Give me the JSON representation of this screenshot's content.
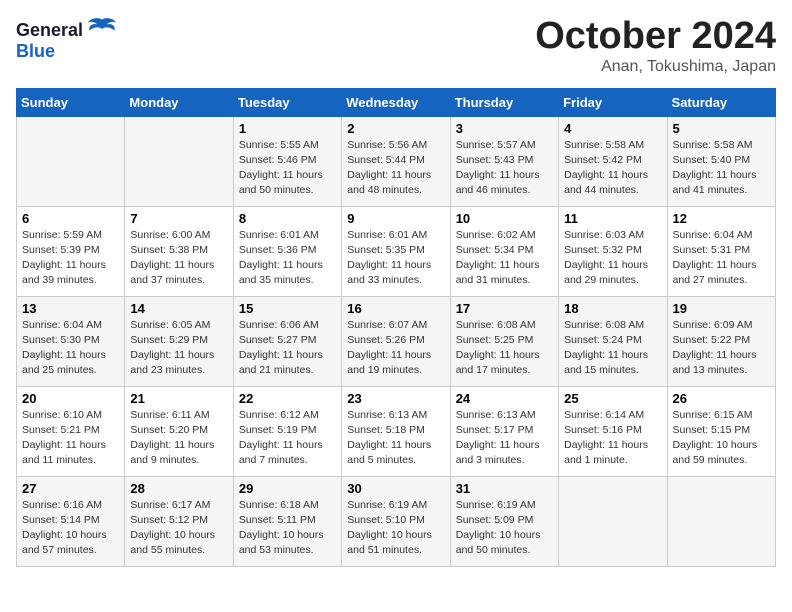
{
  "logo": {
    "general": "General",
    "blue": "Blue"
  },
  "title": "October 2024",
  "location": "Anan, Tokushima, Japan",
  "days_of_week": [
    "Sunday",
    "Monday",
    "Tuesday",
    "Wednesday",
    "Thursday",
    "Friday",
    "Saturday"
  ],
  "weeks": [
    [
      {
        "day": "",
        "info": ""
      },
      {
        "day": "",
        "info": ""
      },
      {
        "day": "1",
        "info": "Sunrise: 5:55 AM\nSunset: 5:46 PM\nDaylight: 11 hours and 50 minutes."
      },
      {
        "day": "2",
        "info": "Sunrise: 5:56 AM\nSunset: 5:44 PM\nDaylight: 11 hours and 48 minutes."
      },
      {
        "day": "3",
        "info": "Sunrise: 5:57 AM\nSunset: 5:43 PM\nDaylight: 11 hours and 46 minutes."
      },
      {
        "day": "4",
        "info": "Sunrise: 5:58 AM\nSunset: 5:42 PM\nDaylight: 11 hours and 44 minutes."
      },
      {
        "day": "5",
        "info": "Sunrise: 5:58 AM\nSunset: 5:40 PM\nDaylight: 11 hours and 41 minutes."
      }
    ],
    [
      {
        "day": "6",
        "info": "Sunrise: 5:59 AM\nSunset: 5:39 PM\nDaylight: 11 hours and 39 minutes."
      },
      {
        "day": "7",
        "info": "Sunrise: 6:00 AM\nSunset: 5:38 PM\nDaylight: 11 hours and 37 minutes."
      },
      {
        "day": "8",
        "info": "Sunrise: 6:01 AM\nSunset: 5:36 PM\nDaylight: 11 hours and 35 minutes."
      },
      {
        "day": "9",
        "info": "Sunrise: 6:01 AM\nSunset: 5:35 PM\nDaylight: 11 hours and 33 minutes."
      },
      {
        "day": "10",
        "info": "Sunrise: 6:02 AM\nSunset: 5:34 PM\nDaylight: 11 hours and 31 minutes."
      },
      {
        "day": "11",
        "info": "Sunrise: 6:03 AM\nSunset: 5:32 PM\nDaylight: 11 hours and 29 minutes."
      },
      {
        "day": "12",
        "info": "Sunrise: 6:04 AM\nSunset: 5:31 PM\nDaylight: 11 hours and 27 minutes."
      }
    ],
    [
      {
        "day": "13",
        "info": "Sunrise: 6:04 AM\nSunset: 5:30 PM\nDaylight: 11 hours and 25 minutes."
      },
      {
        "day": "14",
        "info": "Sunrise: 6:05 AM\nSunset: 5:29 PM\nDaylight: 11 hours and 23 minutes."
      },
      {
        "day": "15",
        "info": "Sunrise: 6:06 AM\nSunset: 5:27 PM\nDaylight: 11 hours and 21 minutes."
      },
      {
        "day": "16",
        "info": "Sunrise: 6:07 AM\nSunset: 5:26 PM\nDaylight: 11 hours and 19 minutes."
      },
      {
        "day": "17",
        "info": "Sunrise: 6:08 AM\nSunset: 5:25 PM\nDaylight: 11 hours and 17 minutes."
      },
      {
        "day": "18",
        "info": "Sunrise: 6:08 AM\nSunset: 5:24 PM\nDaylight: 11 hours and 15 minutes."
      },
      {
        "day": "19",
        "info": "Sunrise: 6:09 AM\nSunset: 5:22 PM\nDaylight: 11 hours and 13 minutes."
      }
    ],
    [
      {
        "day": "20",
        "info": "Sunrise: 6:10 AM\nSunset: 5:21 PM\nDaylight: 11 hours and 11 minutes."
      },
      {
        "day": "21",
        "info": "Sunrise: 6:11 AM\nSunset: 5:20 PM\nDaylight: 11 hours and 9 minutes."
      },
      {
        "day": "22",
        "info": "Sunrise: 6:12 AM\nSunset: 5:19 PM\nDaylight: 11 hours and 7 minutes."
      },
      {
        "day": "23",
        "info": "Sunrise: 6:13 AM\nSunset: 5:18 PM\nDaylight: 11 hours and 5 minutes."
      },
      {
        "day": "24",
        "info": "Sunrise: 6:13 AM\nSunset: 5:17 PM\nDaylight: 11 hours and 3 minutes."
      },
      {
        "day": "25",
        "info": "Sunrise: 6:14 AM\nSunset: 5:16 PM\nDaylight: 11 hours and 1 minute."
      },
      {
        "day": "26",
        "info": "Sunrise: 6:15 AM\nSunset: 5:15 PM\nDaylight: 10 hours and 59 minutes."
      }
    ],
    [
      {
        "day": "27",
        "info": "Sunrise: 6:16 AM\nSunset: 5:14 PM\nDaylight: 10 hours and 57 minutes."
      },
      {
        "day": "28",
        "info": "Sunrise: 6:17 AM\nSunset: 5:12 PM\nDaylight: 10 hours and 55 minutes."
      },
      {
        "day": "29",
        "info": "Sunrise: 6:18 AM\nSunset: 5:11 PM\nDaylight: 10 hours and 53 minutes."
      },
      {
        "day": "30",
        "info": "Sunrise: 6:19 AM\nSunset: 5:10 PM\nDaylight: 10 hours and 51 minutes."
      },
      {
        "day": "31",
        "info": "Sunrise: 6:19 AM\nSunset: 5:09 PM\nDaylight: 10 hours and 50 minutes."
      },
      {
        "day": "",
        "info": ""
      },
      {
        "day": "",
        "info": ""
      }
    ]
  ]
}
